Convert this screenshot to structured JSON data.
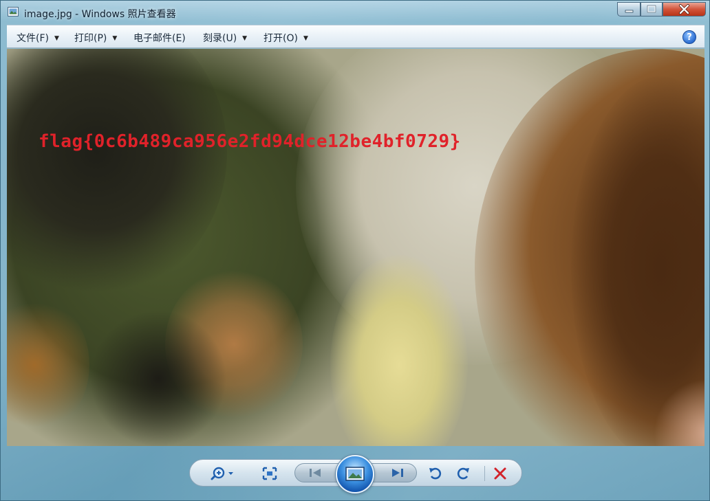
{
  "window": {
    "title": "image.jpg - Windows 照片查看器"
  },
  "menu": {
    "items": [
      {
        "label": "文件(F)",
        "has_dropdown": true
      },
      {
        "label": "打印(P)",
        "has_dropdown": true
      },
      {
        "label": "电子邮件(E)",
        "has_dropdown": false
      },
      {
        "label": "刻录(U)",
        "has_dropdown": true
      },
      {
        "label": "打开(O)",
        "has_dropdown": true
      }
    ],
    "help_label": "?"
  },
  "photo": {
    "overlay_text": "flag{0c6b489ca956e2fd94dce12be4bf0729}",
    "overlay_color": "#e0222a"
  },
  "controls": {
    "icons": [
      "zoom-icon",
      "fit-to-window-icon",
      "previous-icon",
      "slideshow-icon",
      "next-icon",
      "rotate-counterclockwise-icon",
      "rotate-clockwise-icon",
      "delete-icon"
    ]
  },
  "colors": {
    "accent": "#2a6cd1",
    "delete": "#d2232a"
  }
}
